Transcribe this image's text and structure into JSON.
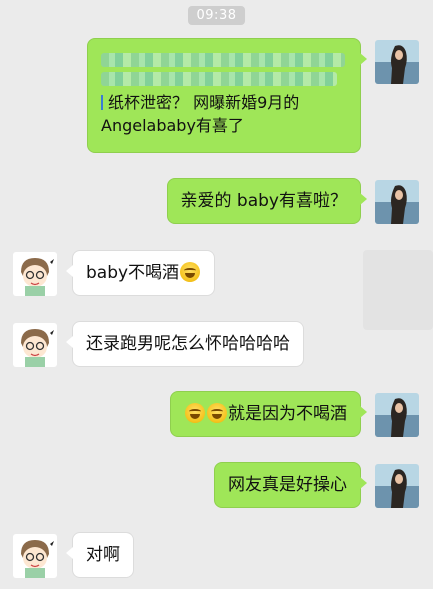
{
  "timestamp": "09:38",
  "messages": [
    {
      "side": "right",
      "type": "quote",
      "quote_text": "纸杯泄密？ 网曝新婚9月的",
      "quote_text2": "Angelababy有喜了"
    },
    {
      "side": "right",
      "type": "text",
      "text": "亲爱的 baby有喜啦？"
    },
    {
      "side": "left",
      "type": "text",
      "text": "baby不喝酒",
      "trailing_emoji": "laugh-cry"
    },
    {
      "side": "left",
      "type": "text",
      "text": "还录跑男呢怎么怀哈哈哈哈"
    },
    {
      "side": "right",
      "type": "text",
      "leading_emojis": [
        "laugh-cry",
        "laugh-cry"
      ],
      "text": "就是因为不喝酒"
    },
    {
      "side": "right",
      "type": "text",
      "text": "网友真是好操心"
    },
    {
      "side": "left",
      "type": "text",
      "text": "对啊"
    }
  ],
  "colors": {
    "background": "#ebebeb",
    "outgoing_bubble": "#9fe658",
    "incoming_bubble": "#ffffff",
    "timestamp_bg": "#cecece"
  },
  "icons": {
    "self_avatar": "woman-by-lake-avatar",
    "other_avatar": "cartoon-girl-avatar",
    "emoji": "laugh-cry-emoji"
  }
}
